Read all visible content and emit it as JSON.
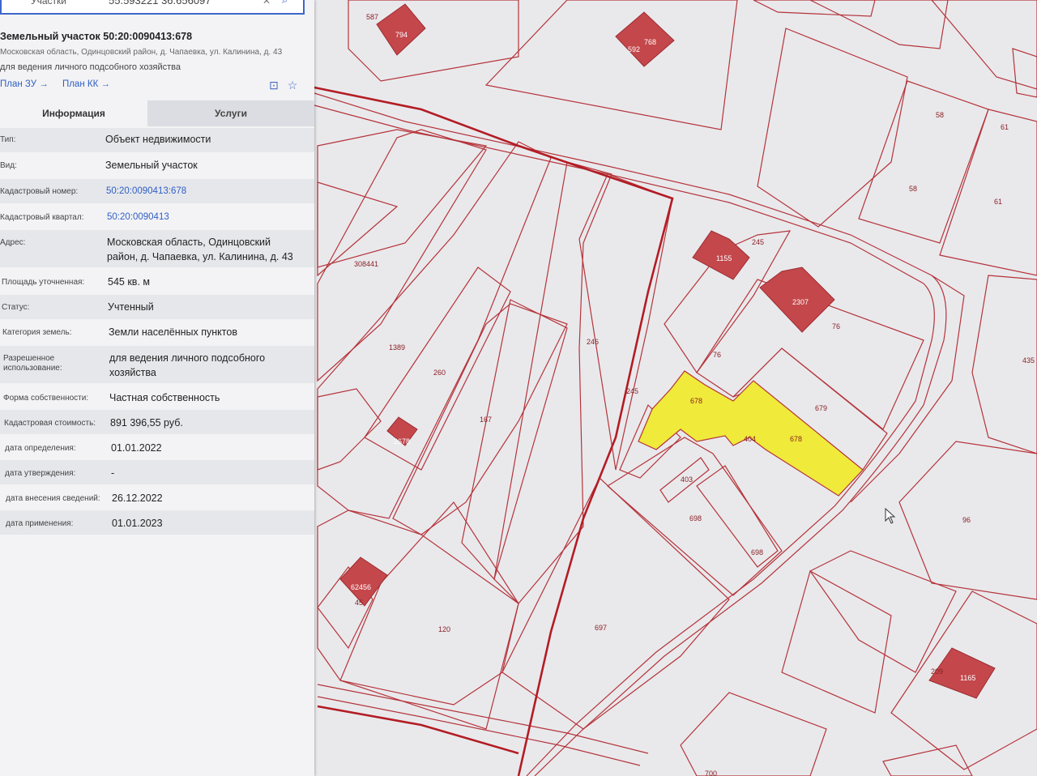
{
  "search": {
    "label": "Участки",
    "coords": "55.593221 36.656097"
  },
  "parcel": {
    "title": "Земельный участок 50:20:0090413:678",
    "address_line": "Московская область, Одинцовский район, д. Чапаевка, ул. Калинина, д. 43",
    "use_line": "для ведения личного подсобного хозяйства"
  },
  "links": {
    "plan_zu": "План ЗУ →",
    "plan_kk": "План КК →"
  },
  "tabs": {
    "info": "Информация",
    "services": "Услуги"
  },
  "rows": [
    {
      "key": "Тип:",
      "value": "Объект недвижимости",
      "link": false
    },
    {
      "key": "Вид:",
      "value": "Земельный участок",
      "link": false
    },
    {
      "key": "Кадастровый номер:",
      "value": "50:20:0090413:678",
      "link": true
    },
    {
      "key": "Кадастровый квартал:",
      "value": "50:20:0090413",
      "link": true
    },
    {
      "key": "Адрес:",
      "value": "Московская область, Одинцовский",
      "value2": "район, д. Чапаевка, ул. Калинина, д. 43",
      "link": false
    },
    {
      "key": "Площадь уточненная:",
      "value": "545 кв. м",
      "link": false
    },
    {
      "key": "Статус:",
      "value": "Учтенный",
      "link": false
    },
    {
      "key": "Категория земель:",
      "value": "Земли населённых пунктов",
      "link": false
    },
    {
      "key": "Разрешенное",
      "key2": "использование:",
      "value": "для ведения личного подсобного",
      "value2": "хозяйства",
      "link": false
    },
    {
      "key": "Форма собственности:",
      "value": "Частная собственность",
      "link": false
    },
    {
      "key": "Кадастровая стоимость:",
      "value": "891 396,55 руб.",
      "link": false
    },
    {
      "key": "дата определения:",
      "value": "01.01.2022",
      "link": false
    },
    {
      "key": "дата утверждения:",
      "value": "-",
      "link": false
    },
    {
      "key": "дата внесения сведений:",
      "value": "26.12.2022",
      "link": false
    },
    {
      "key": "дата применения:",
      "value": "01.01.2023",
      "link": false
    }
  ],
  "map_labels": [
    "587",
    "794",
    "592",
    "768",
    "58",
    "61",
    "58",
    "61",
    "245",
    "1155",
    "2307",
    "76",
    "76",
    "435",
    "308441",
    "1389",
    "260",
    "246",
    "167",
    "245",
    "678",
    "679",
    "404",
    "678",
    "403",
    "698",
    "698",
    "96",
    "45",
    "62456",
    "120",
    "697",
    "209",
    "1165",
    "700",
    "2678"
  ],
  "colors": {
    "boundary": "#b5343a",
    "building": "#c4474b",
    "selected": "#f0ea3a",
    "link": "#2f5fc4"
  }
}
